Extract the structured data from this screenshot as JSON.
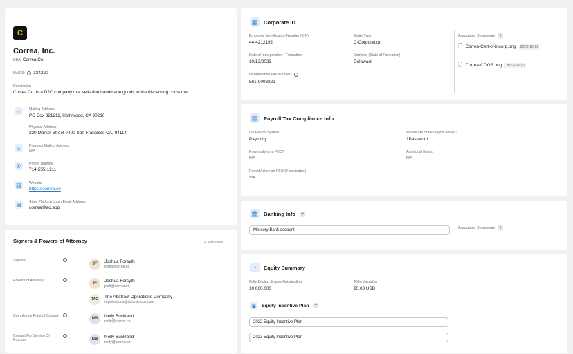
{
  "company": {
    "logo_letter": "C",
    "name": "Correa, Inc.",
    "dba_label": "DBA:",
    "dba": "Correa Co.",
    "naics_label": "NAICS:",
    "naics": "334220",
    "description_label": "Description",
    "description": "Correa Co. is a D2C company that sells fine handmade goods to the discerning consumer",
    "mailing_label": "Mailing Address",
    "mailing": "PO Box 321211, Hollywood, CA 90210",
    "physical_label": "Physical Address",
    "physical": "220 Market Street #400 San Francisco CA, 94114",
    "prev_label": "Previous Mailing Address",
    "prev": "N/A",
    "phone_label": "Phone Number",
    "phone": "714-555-1211",
    "website_label": "Website",
    "website": "https://correa.co",
    "email_label": "State Platform Login Email Address",
    "email": "correa@ao.app"
  },
  "signers": {
    "title": "Signers & Powers of Attorney",
    "add_label": "+ Add New",
    "rows": [
      {
        "label": "Signers",
        "people": [
          {
            "initials": "JF",
            "name": "Joshua Forsyth",
            "email": "josh@correa.co"
          }
        ]
      },
      {
        "label": "Powers of Attorney",
        "people": [
          {
            "initials": "JF",
            "name": "Joshua Forsyth",
            "email": "josh@correa.co"
          },
          {
            "initials": "TAO",
            "name": "The Abstract Operations Company",
            "email": "registrations@abstractops.com"
          }
        ]
      },
      {
        "label": "Compliance Point of Contact",
        "people": [
          {
            "initials": "NB",
            "name": "Nelly Buckland",
            "email": "nelly@correa.co"
          }
        ]
      },
      {
        "label_line1": "Contact For Service Of",
        "label_line2": "Process",
        "people": [
          {
            "initials": "NB",
            "name": "Nelly Buckland",
            "email": "nelly@correa.co"
          }
        ]
      }
    ]
  },
  "corporate": {
    "title": "Corporate ID",
    "ein_label": "Employer Identification Number (EIN)",
    "ein": "44-4212192",
    "entity_label": "Entity Type",
    "entity": "C-Corporation",
    "incorp_date_label": "Date of Incorporation / Formation",
    "incorp_date": "10/12/2023",
    "domicile_label": "Domicile (State of Formation)",
    "domicile": "Delaware",
    "file_label": "Incorporation File Number",
    "file": "561-9003222",
    "docs_label": "Associated Documents",
    "docs": [
      {
        "name": "Correa-Cert-of-incorp.png",
        "date": "2023-10-12"
      },
      {
        "name": "Correa-COGS.png",
        "date": "2023-10-12"
      }
    ]
  },
  "payroll": {
    "title": "Payroll Tax Compliance Info",
    "system_label": "US Payroll System",
    "system": "Paylocity",
    "logins_label": "Where are State Logins Stored?",
    "logins": "1Password",
    "peo_label": "Previously on a PEO?",
    "peo": "N/A",
    "notes_label": "Additional Notes",
    "notes": "N/A",
    "period_label": "Period Active on PEO (if applicable)",
    "period": "N/A"
  },
  "banking": {
    "title": "Banking Info",
    "account": "Mercury Bank account",
    "docs_label": "Associated Documents"
  },
  "equity": {
    "title": "Equity Summary",
    "shares_label": "Fully-Diluted Shares Outstanding",
    "shares": "10,000,000",
    "valuation_label": "409a Valuation",
    "valuation": "$0.03 USD",
    "plan_title": "Equity Incentive Plan",
    "plans": [
      "2022 Equity Incentive Plan",
      "2023 Equity Incentive Plan"
    ]
  },
  "colors": {
    "accent": "#2a78c2",
    "icon_bg": "#e4eef8",
    "avatar_jf": "#f1e3d3",
    "avatar_tao": "#efeadf",
    "avatar_nb": "#e7dcf3"
  }
}
